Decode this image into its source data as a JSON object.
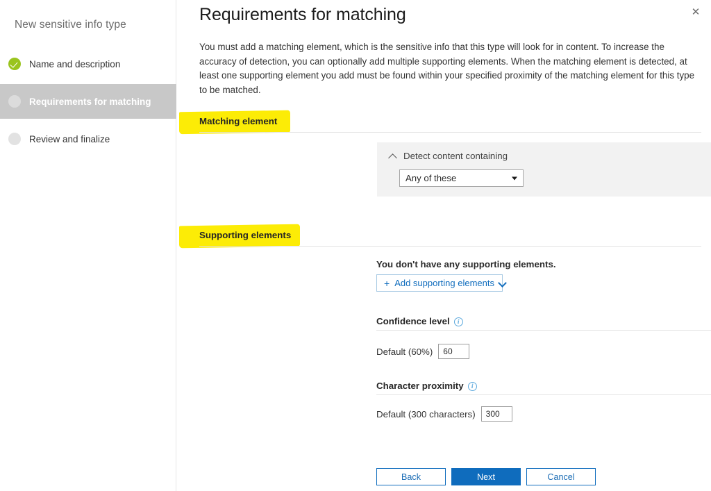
{
  "wizard": {
    "title": "New sensitive info type",
    "steps": [
      {
        "label": "Name and description",
        "state": "completed"
      },
      {
        "label": "Requirements for matching",
        "state": "current"
      },
      {
        "label": "Review and finalize",
        "state": "pending"
      }
    ]
  },
  "page": {
    "title": "Requirements for matching",
    "description": "You must add a matching element, which is the sensitive info that this type will look for in content. To increase the accuracy of detection, you can optionally add multiple supporting elements. When the matching element is detected, at least one supporting element you add must be found within your specified proximity of the matching element for this type to be matched.",
    "close_icon": "close-icon"
  },
  "matching_element": {
    "section_title": "Matching element",
    "highlight_color": "#fcec06",
    "card": {
      "collapse_icon": "chevron-up-icon",
      "label": "Detect content containing",
      "remove_icon": "close-icon",
      "select": {
        "value": "Any of these",
        "caret_icon": "chevron-down-icon",
        "options": [
          "Any of these"
        ]
      }
    }
  },
  "supporting_elements": {
    "section_title": "Supporting elements",
    "highlight_color": "#fcec06",
    "empty_message": "You don't have any supporting elements.",
    "add_button": {
      "plus_icon": "plus-icon",
      "label": "Add supporting elements",
      "chevron_icon": "chevron-down-icon"
    }
  },
  "confidence_level": {
    "title": "Confidence level",
    "info_icon": "info-icon",
    "row_label": "Default (60%)",
    "value": "60"
  },
  "character_proximity": {
    "title": "Character proximity",
    "info_icon": "info-icon",
    "row_label": "Default (300 characters)",
    "value": "300"
  },
  "footer": {
    "back_label": "Back",
    "next_label": "Next",
    "cancel_label": "Cancel",
    "primary_color": "#0f6cbd"
  }
}
